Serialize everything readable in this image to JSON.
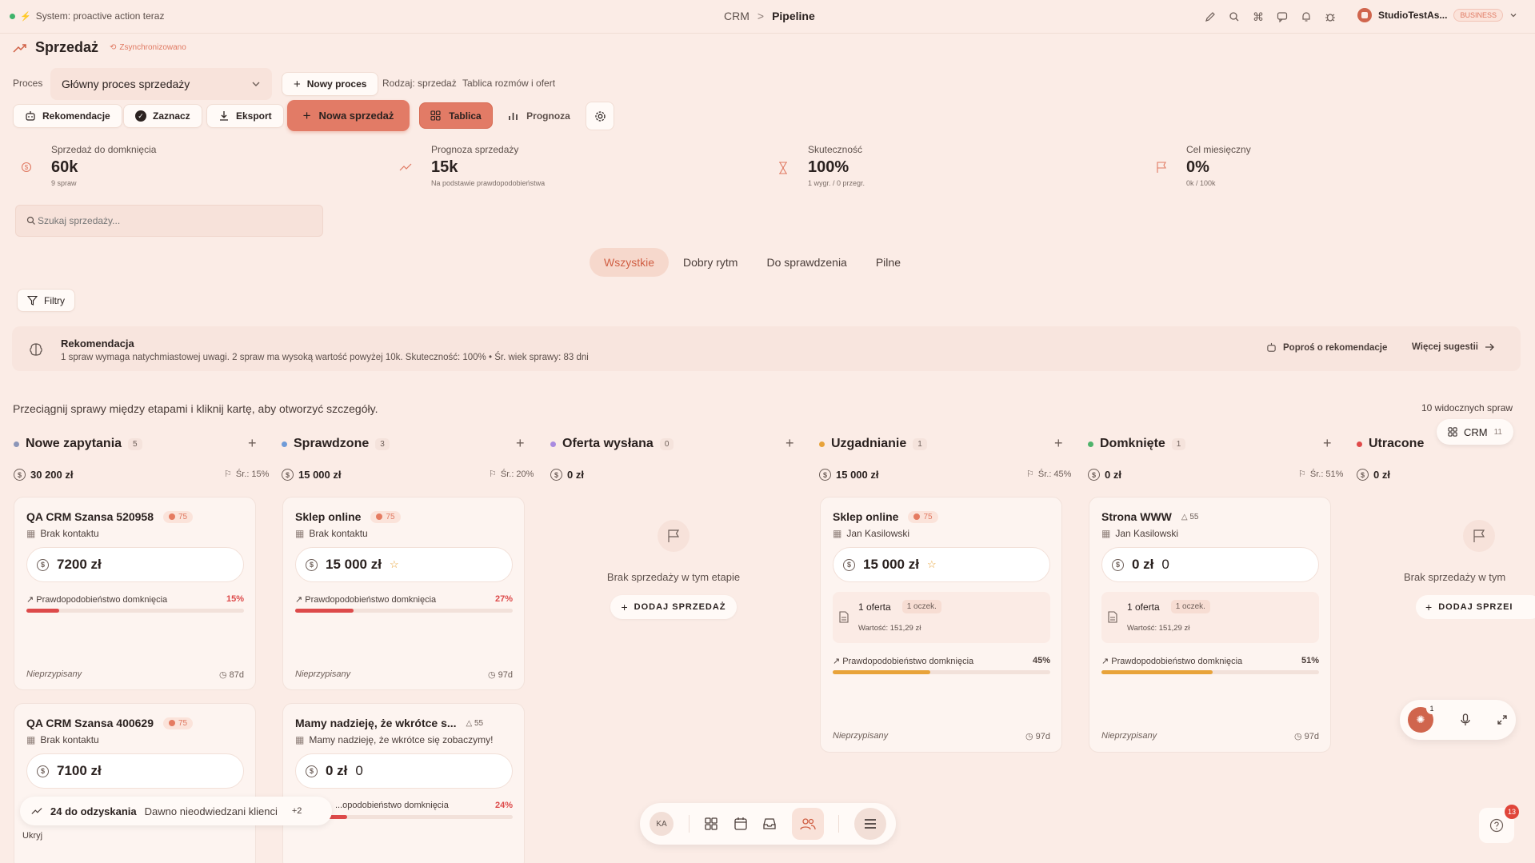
{
  "topbar": {
    "system_status": "System: proactive action teraz",
    "breadcrumb_root": "CRM",
    "breadcrumb_sep": ">",
    "breadcrumb_current": "Pipeline",
    "workspace_name": "StudioTestAs...",
    "workspace_badge": "BUSINESS"
  },
  "page": {
    "title": "Sprzedaż",
    "sync_status": "Zsynchronizowano"
  },
  "process": {
    "label": "Proces",
    "selected": "Główny proces sprzedaży",
    "new_button": "Nowy proces",
    "meta_type": "Rodzaj: sprzedaż",
    "meta_board": "Tablica rozmów i ofert"
  },
  "toolbar": {
    "recommendations": "Rekomendacje",
    "select": "Zaznacz",
    "export": "Eksport",
    "new_sale": "Nowa sprzedaż",
    "view_board": "Tablica",
    "view_forecast": "Prognoza"
  },
  "stats": [
    {
      "label": "Sprzedaż do domknięcia",
      "value": "60k",
      "sub": "9 spraw"
    },
    {
      "label": "Prognoza sprzedaży",
      "value": "15k",
      "sub": "Na podstawie prawdopodobieństwa"
    },
    {
      "label": "Skuteczność",
      "value": "100%",
      "sub": "1 wygr. / 0 przegr."
    },
    {
      "label": "Cel miesięczny",
      "value": "0%",
      "sub": "0k / 100k"
    }
  ],
  "search": {
    "placeholder": "Szukaj sprzedaży..."
  },
  "tabs": [
    "Wszystkie",
    "Dobry rytm",
    "Do sprawdzenia",
    "Pilne"
  ],
  "filters_label": "Filtry",
  "recommendation": {
    "title": "Rekomendacja",
    "text": "1 spraw wymaga natychmiastowej uwagi. 2 spraw ma wysoką wartość powyżej 10k. Skuteczność: 100% • Śr. wiek sprawy: 83 dni",
    "ask": "Poproś o rekomendacje",
    "more": "Więcej sugestii"
  },
  "hint": "Przeciągnij sprawy między etapami i kliknij kartę, aby otworzyć szczegóły.",
  "visible_count": "10 widocznych spraw",
  "crm_chip": {
    "label": "CRM",
    "count": "11"
  },
  "columns": [
    {
      "title": "Nowe zapytania",
      "count": "5",
      "sum": "30 200 zł",
      "avg": "Śr.: 15%",
      "color": "#8c96b8"
    },
    {
      "title": "Sprawdzone",
      "count": "3",
      "sum": "15 000 zł",
      "avg": "Śr.: 20%",
      "color": "#6f9bd8"
    },
    {
      "title": "Oferta wysłana",
      "count": "0",
      "sum": "0 zł",
      "avg": "",
      "color": "#a98be0"
    },
    {
      "title": "Uzgadnianie",
      "count": "1",
      "sum": "15 000 zł",
      "avg": "Śr.: 45%",
      "color": "#e8a33a"
    },
    {
      "title": "Domknięte",
      "count": "1",
      "sum": "0 zł",
      "avg": "Śr.: 51%",
      "color": "#4fb36b"
    },
    {
      "title": "Utracone",
      "count": "",
      "sum": "0 zł",
      "avg": "",
      "color": "#e04a4a"
    }
  ],
  "cards": {
    "c1": {
      "title": "QA CRM Szansa 520958",
      "score": "75",
      "contact": "Brak kontaktu",
      "amount": "7200 zł",
      "prob_label": "Prawdopodobieństwo domknięcia",
      "prob": "15%",
      "prob_value": 0.15,
      "owner": "Nieprzypisany",
      "age": "87d"
    },
    "c2": {
      "title": "QA CRM Szansa 400629",
      "score": "75",
      "contact": "Brak kontaktu",
      "amount": "7100 zł"
    },
    "c3": {
      "title": "Sklep online",
      "score": "75",
      "contact": "Brak kontaktu",
      "amount": "15 000 zł",
      "prob_label": "Prawdopodobieństwo domknięcia",
      "prob": "27%",
      "prob_value": 0.27,
      "owner": "Nieprzypisany",
      "age": "97d"
    },
    "c4": {
      "title": "Mamy nadzieję, że wkrótce s...",
      "score": "55",
      "contact": "Mamy nadzieję, że wkrótce się zobaczymy!",
      "amount": "0 zł",
      "amount_extra": "0",
      "prob_label": "...opodobieństwo domknięcia",
      "prob": "24%",
      "prob_value": 0.24
    },
    "c5": {
      "title": "Sklep online",
      "score": "75",
      "contact": "Jan Kasilowski",
      "amount": "15 000 zł",
      "offer": "1 oferta",
      "offer_badge": "1 oczek.",
      "offer_value": "Wartość: 151,29 zł",
      "prob_label": "Prawdopodobieństwo domknięcia",
      "prob": "45%",
      "prob_value": 0.45,
      "owner": "Nieprzypisany",
      "age": "97d"
    },
    "c6": {
      "title": "Strona WWW",
      "score": "55",
      "contact": "Jan Kasilowski",
      "amount": "0 zł",
      "amount_extra": "0",
      "offer": "1 oferta",
      "offer_badge": "1 oczek.",
      "offer_value": "Wartość: 151,29 zł",
      "prob_label": "Prawdopodobieństwo domknięcia",
      "prob": "51%",
      "prob_value": 0.51,
      "owner": "Nieprzypisany",
      "age": "97d"
    }
  },
  "empty": {
    "text": "Brak sprzedaży w tym etapie",
    "add": "DODAJ SPRZEDAŻ",
    "text_cut": "Brak sprzedaży w tym",
    "add_cut": "DODAJ SPRZEI"
  },
  "recovery": {
    "count": "24 do odzyskania",
    "text": "Dawno nieodwiedzani klienci",
    "more": "+2",
    "hide": "Ukryj"
  },
  "dock": {
    "avatar": "KA"
  },
  "assistant_badge": "1",
  "help_badge": "13",
  "colors": {
    "accent": "#e07a63",
    "accent_dark": "#d05f44",
    "red_bar": "#dd4a4a",
    "amber_bar": "#e8a33a"
  }
}
